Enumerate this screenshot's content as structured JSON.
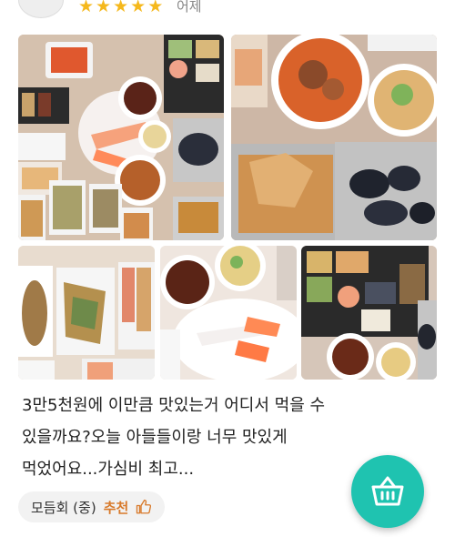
{
  "header": {
    "rating_stars": 5,
    "star_glyph": "★",
    "date": "어제"
  },
  "photos": [
    {
      "name": "photo-full-spread"
    },
    {
      "name": "photo-stew-and-mussels"
    },
    {
      "name": "photo-fried-fish"
    },
    {
      "name": "photo-sashimi-plate"
    },
    {
      "name": "photo-side-dishes"
    }
  ],
  "review": {
    "line1": "3만5천원에 이만큼 맛있는거 어디서 먹을 수",
    "line2": "있을까요?오늘 아들들이랑 너무 맛있게",
    "line3": "먹었어요...가심비 최고..."
  },
  "tag": {
    "menu_name": "모듬회 (중)",
    "recommend_label": "추천",
    "icon": "thumbs-up-icon"
  },
  "fab": {
    "icon": "basket-icon",
    "color": "#1fc3b0"
  },
  "colors": {
    "star": "#f5b81c",
    "recommend": "#d87a2b"
  }
}
